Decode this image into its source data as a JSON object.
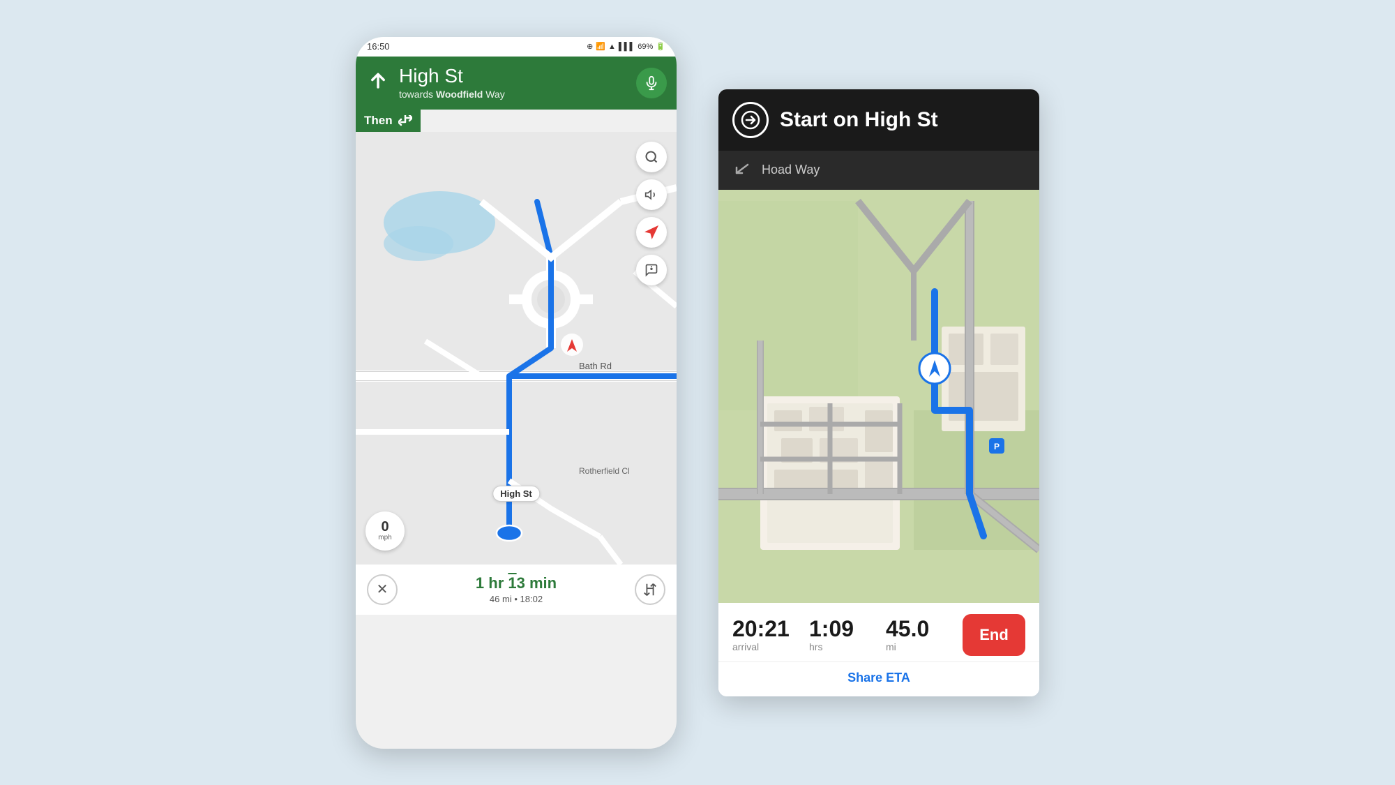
{
  "page": {
    "background_color": "#dce8f0"
  },
  "left_phone": {
    "status_bar": {
      "time": "16:50",
      "battery": "69%"
    },
    "nav_header": {
      "street_name_bold": "High",
      "street_name_suffix": " St",
      "towards_label": "towards",
      "towards_street_bold": "Woodfield",
      "towards_street_suffix": " Way",
      "then_label": "Then"
    },
    "map": {
      "road_labels": [
        "Bath Rd",
        "Bath Rd",
        "Rotherfield Cl"
      ],
      "street_chip": "High St"
    },
    "controls": {
      "search_icon": "🔍",
      "sound_icon": "🔊",
      "location_icon": "📍",
      "chat_icon": "💬"
    },
    "speed": {
      "value": "0",
      "unit": "mph"
    },
    "bottom_bar": {
      "eta_time": "1 hr 13 min",
      "eta_time_display": "1 hr 13 min",
      "distance": "46 mi",
      "arrival": "18:02"
    }
  },
  "right_phone": {
    "nav_header_top": {
      "title": "Start on High St"
    },
    "nav_header_sub": {
      "street": "Hoad Way"
    },
    "stats": {
      "arrival_value": "20:21",
      "arrival_label": "arrival",
      "hrs_value": "1:09",
      "hrs_label": "hrs",
      "mi_value": "45.0",
      "mi_label": "mi",
      "end_label": "End"
    },
    "share_eta": {
      "label": "Share ETA"
    }
  }
}
